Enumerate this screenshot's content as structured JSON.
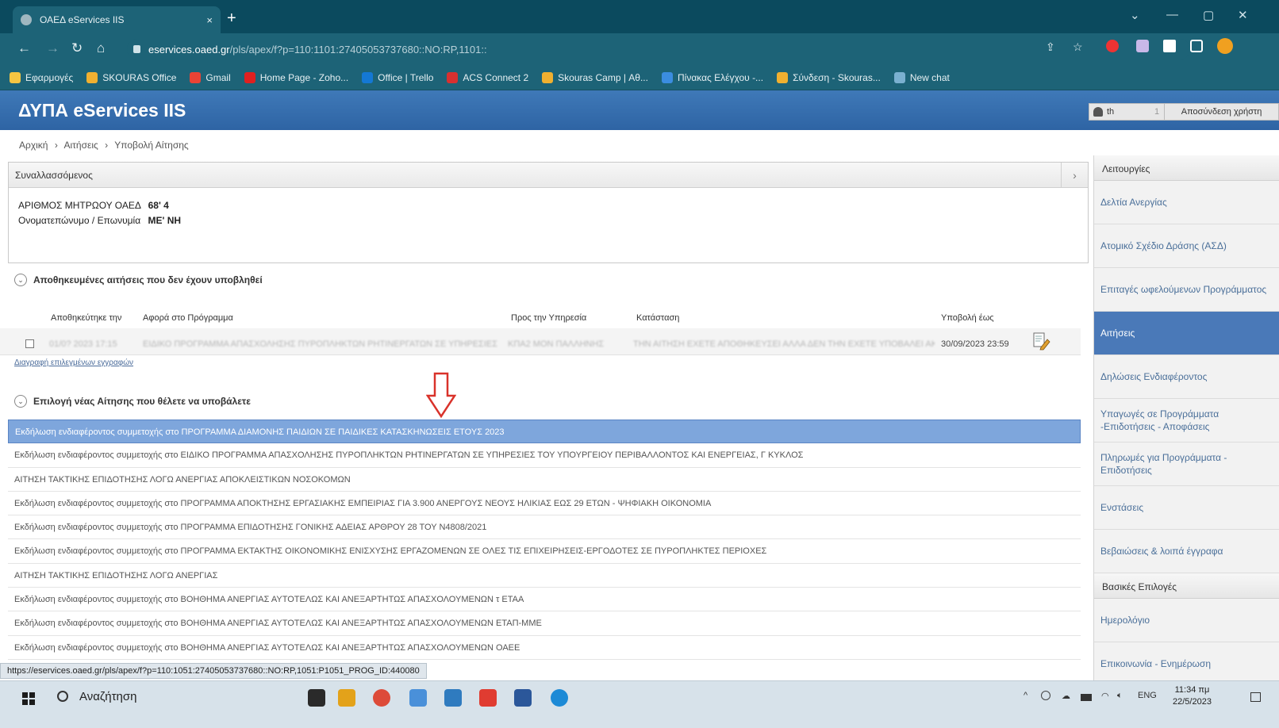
{
  "browser": {
    "tab_title": "ΟΑΕΔ eServices IIS",
    "tab_close": "×",
    "new_tab": "+",
    "url_host": "eservices.oaed.gr",
    "url_path": "/pls/apex/f?p=110:1101:27405053737680::NO:RP,1101::",
    "bookmarks": [
      "Εφαρμογές",
      "SKOURAS Office",
      "Gmail",
      "Home Page - Zoho...",
      "Office | Trello",
      "ACS Connect 2",
      "Skouras Camp | Αθ...",
      "Πίνακας Ελέγχου -...",
      "Σύνδεση - Skouras...",
      "New chat"
    ],
    "bookmark_colors": [
      "#f5c542",
      "#f0b030",
      "#ea4335",
      "#e02020",
      "#1478d4",
      "#d83030",
      "#f0b030",
      "#3b8de0",
      "#f0b030",
      "#7ab0d0"
    ],
    "status_url": "https://eservices.oaed.gr/pls/apex/f?p=110:1051:27405053737680::NO:RP,1051:P1051_PROG_ID:440080"
  },
  "app": {
    "title": "ΔΥΠΑ eServices IIS",
    "user": "th",
    "user_sep": "1",
    "logout": "Αποσύνδεση χρήστη"
  },
  "breadcrumb": [
    "Αρχική",
    "›",
    "Αιτήσεις",
    "›",
    "Υποβολή Αίτησης"
  ],
  "person": {
    "header": "Συναλλασσόμενος",
    "toggle": "›",
    "reg_label": "ΑΡΙΘΜΟΣ ΜΗΤΡΩΟΥ ΟΑΕΔ",
    "reg_value": "68'        4",
    "name_label": "Ονοματεπώνυμο / Επωνυμία",
    "name_value": "ΜΕ'                                                  ΝΗ"
  },
  "saved": {
    "title": "Αποθηκευμένες αιτήσεις που δεν έχουν υποβληθεί",
    "columns": [
      "Αποθηκεύτηκε την",
      "Αφορά στο Πρόγραμμα",
      "Προς την Υπηρεσία",
      "Κατάσταση",
      "Υποβολή έως"
    ],
    "row": {
      "saved_on": "01/0? 2023 17:15",
      "program": "ΕΙΔΙΚΟ ΠΡΟΓΡΑΜΜΑ ΑΠΑΣΧΟΛΗΣΗΣ ΠΥΡΟΠΛΗΚΤΩΝ ΡΗΤΙΝΕΡΓΑΤΩΝ ΣΕ ΥΠΗΡΕΣΙΕΣ",
      "service": "ΚΠΑ2 ΜΟΝ ΠΑΛΛΗΝΗΣ",
      "status": "ΤΗΝ ΑΙΤΗΣΗ ΕΧΕΤΕ ΑΠΟΘΗΚΕΥΣΕΙ ΑΛΛΑ ΔΕΝ ΤΗΝ ΕΧΕΤΕ ΥΠΟΒΑΛΕΙ ΑΚΟΜΗ",
      "submit_until": "30/09/2023 23:59"
    },
    "delete_link": "Διαγραφή επιλεγμένων εγγραφών"
  },
  "new_app": {
    "title": "Επιλογή νέας Αίτησης που θέλετε να υποβάλετε",
    "items": [
      "Εκδήλωση ενδιαφέροντος συμμετοχής στο ΠΡΟΓΡΑΜΜΑ ΔΙΑΜΟΝΗΣ ΠΑΙΔΙΩΝ ΣΕ ΠΑΙΔΙΚΕΣ ΚΑΤΑΣΚΗΝΩΣΕΙΣ ΕΤΟΥΣ 2023",
      "Εκδήλωση ενδιαφέροντος συμμετοχής στο ΕΙΔΙΚΟ ΠΡΟΓΡΑΜΜΑ ΑΠΑΣΧΟΛΗΣΗΣ ΠΥΡΟΠΛΗΚΤΩΝ ΡΗΤΙΝΕΡΓΑΤΩΝ ΣΕ ΥΠΗΡΕΣΙΕΣ ΤΟΥ ΥΠΟΥΡΓΕΙΟΥ ΠΕΡΙΒΑΛΛΟΝΤΟΣ ΚΑΙ ΕΝΕΡΓΕΙΑΣ, Γ ΚΥΚΛΟΣ",
      "ΑΙΤΗΣΗ ΤΑΚΤΙΚΗΣ ΕΠΙΔΟΤΗΣΗΣ ΛΟΓΩ ΑΝΕΡΓΙΑΣ ΑΠΟΚΛΕΙΣΤΙΚΩΝ ΝΟΣΟΚΟΜΩΝ",
      "Εκδήλωση ενδιαφέροντος συμμετοχής στο ΠΡΟΓΡΑΜΜΑ ΑΠΟΚΤΗΣΗΣ ΕΡΓΑΣΙΑΚΗΣ ΕΜΠΕΙΡΙΑΣ ΓΙΑ 3.900 ΑΝΕΡΓΟΥΣ ΝΕΟΥΣ ΗΛΙΚΙΑΣ ΕΩΣ 29 ΕΤΩΝ - ΨΗΦΙΑΚΗ ΟΙΚΟΝΟΜΙΑ",
      "Εκδήλωση ενδιαφέροντος συμμετοχής στο ΠΡΟΓΡΑΜΜΑ ΕΠΙΔΟΤΗΣΗΣ ΓΟΝΙΚΗΣ ΑΔΕΙΑΣ ΑΡΘΡΟΥ 28 ΤΟΥ Ν4808/2021",
      "Εκδήλωση ενδιαφέροντος συμμετοχής στο ΠΡΟΓΡΑΜΜΑ ΕΚΤΑΚΤΗΣ ΟΙΚΟΝΟΜΙΚΗΣ ΕΝΙΣΧΥΣΗΣ ΕΡΓΑΖΟΜΕΝΩΝ ΣΕ ΟΛΕΣ ΤΙΣ ΕΠΙΧΕΙΡΗΣΕΙΣ-ΕΡΓΟΔΟΤΕΣ ΣΕ ΠΥΡΟΠΛΗΚΤΕΣ ΠΕΡΙΟΧΕΣ",
      "ΑΙΤΗΣΗ ΤΑΚΤΙΚΗΣ ΕΠΙΔΟΤΗΣΗΣ ΛΟΓΩ ΑΝΕΡΓΙΑΣ",
      "Εκδήλωση ενδιαφέροντος συμμετοχής στο ΒΟΗΘΗΜΑ ΑΝΕΡΓΙΑΣ ΑΥΤΟΤΕΛΩΣ ΚΑΙ ΑΝΕΞΑΡΤΗΤΩΣ ΑΠΑΣΧΟΛΟΥΜΕΝΩΝ τ ΕΤΑΑ",
      "Εκδήλωση ενδιαφέροντος συμμετοχής στο ΒΟΗΘΗΜΑ ΑΝΕΡΓΙΑΣ ΑΥΤΟΤΕΛΩΣ ΚΑΙ ΑΝΕΞΑΡΤΗΤΩΣ ΑΠΑΣΧΟΛΟΥΜΕΝΩΝ ΕΤΑΠ-ΜΜΕ",
      "Εκδήλωση ενδιαφέροντος συμμετοχής στο ΒΟΗΘΗΜΑ ΑΝΕΡΓΙΑΣ ΑΥΤΟΤΕΛΩΣ ΚΑΙ ΑΝΕΞΑΡΤΗΤΩΣ ΑΠΑΣΧΟΛΟΥΜΕΝΩΝ ΟΑΕΕ"
    ],
    "selected_index": 0
  },
  "sidebar": {
    "functions_header": "Λειτουργίες",
    "functions": [
      "Δελτία Ανεργίας",
      "Ατομικό Σχέδιο Δράσης (ΑΣΔ)",
      "Επιταγές ωφελούμενων Προγράμματος",
      "Αιτήσεις",
      "Δηλώσεις Ενδιαφέροντος",
      "Υπαγωγές σε Προγράμματα -Επιδοτήσεις - Αποφάσεις",
      "Πληρωμές για Προγράμματα - Επιδοτήσεις",
      "Ενστάσεις",
      "Βεβαιώσεις & λοιπά έγγραφα"
    ],
    "active_index": 3,
    "basic_header": "Βασικές Επιλογές",
    "basic": [
      "Ημερολόγιο",
      "Επικοινωνία - Ενημέρωση"
    ]
  },
  "taskbar": {
    "search": "Αναζήτηση",
    "lang": "ENG",
    "time": "11:34 πμ",
    "date": "22/5/2023",
    "app_colors": [
      "#2a2a2a",
      "#e3a21a",
      "#dd4b39",
      "#4a90d9",
      "#2f7bbf",
      "#e03c31",
      "#2b579a",
      "#1c8ad6"
    ]
  },
  "colors": {
    "header_blue": "#2e64a4",
    "selected_row": "#7ea6dc",
    "sidebar_active": "#4a79b8",
    "arrow_red": "#d9322a"
  }
}
